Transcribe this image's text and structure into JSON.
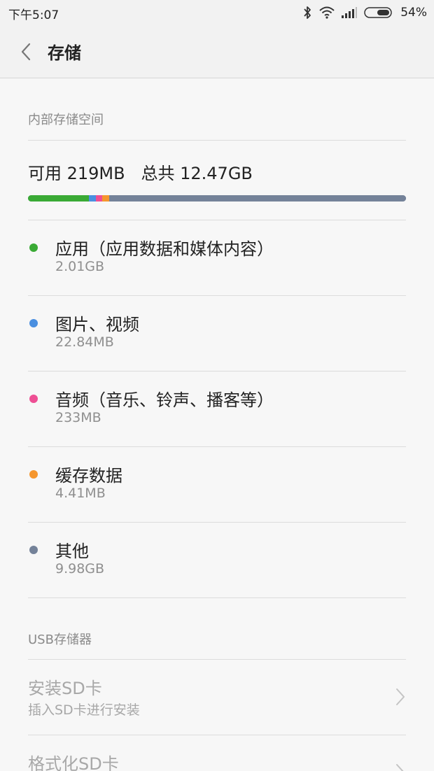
{
  "status_bar": {
    "time": "下午5:07",
    "battery_percent": "54%",
    "icons": [
      "bluetooth-icon",
      "wifi-icon",
      "signal-icon",
      "battery-icon"
    ]
  },
  "header": {
    "title": "存储",
    "back_icon": "chevron-left-icon"
  },
  "internal": {
    "section_title": "内部存储空间",
    "summary": "可用 219MB   总共 12.47GB",
    "usage_segments": [
      {
        "name": "apps",
        "fraction": 0.161,
        "color": "#3aaa35"
      },
      {
        "name": "images-videos",
        "fraction": 0.018,
        "color": "#4a8fe0"
      },
      {
        "name": "audio",
        "fraction": 0.018,
        "color": "#ee4f94"
      },
      {
        "name": "cache",
        "fraction": 0.018,
        "color": "#f5962e"
      },
      {
        "name": "other",
        "fraction": 0.785,
        "color": "#748299"
      }
    ],
    "items": [
      {
        "title": "应用（应用数据和媒体内容）",
        "value": "2.01GB",
        "color": "#3aaa35"
      },
      {
        "title": "图片、视频",
        "value": "22.84MB",
        "color": "#4a8fe0"
      },
      {
        "title": "音频（音乐、铃声、播客等）",
        "value": "233MB",
        "color": "#ee4f94"
      },
      {
        "title": "缓存数据",
        "value": "4.41MB",
        "color": "#f5962e"
      },
      {
        "title": "其他",
        "value": "9.98GB",
        "color": "#748299"
      }
    ]
  },
  "usb": {
    "section_title": "USB存储器",
    "items": [
      {
        "title": "安装SD卡",
        "subtitle": "插入SD卡进行安装"
      },
      {
        "title": "格式化SD卡",
        "subtitle": ""
      }
    ]
  }
}
